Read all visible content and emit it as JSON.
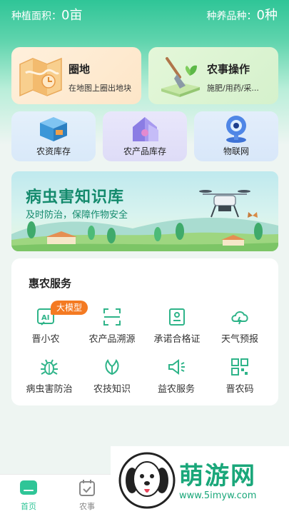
{
  "stats": {
    "area_label": "种植面积：",
    "area_value": "0亩",
    "variety_label": "种养品种：",
    "variety_value": "0种"
  },
  "cards": {
    "plot": {
      "title": "圈地",
      "subtitle": "在地图上圈出地块"
    },
    "ops": {
      "title": "农事操作",
      "subtitle": "施肥/用药/采..."
    }
  },
  "shortcuts": [
    {
      "label": "农资库存",
      "icon": "warehouse-box-icon"
    },
    {
      "label": "农产品库存",
      "icon": "house-icon"
    },
    {
      "label": "物联网",
      "icon": "camera-icon"
    }
  ],
  "banner": {
    "title": "病虫害知识库",
    "subtitle": "及时防治，保障作物安全"
  },
  "service": {
    "title": "惠农服务",
    "badge": "大模型",
    "items": [
      {
        "label": "晋小农",
        "icon": "ai-icon"
      },
      {
        "label": "农产品溯源",
        "icon": "scan-icon"
      },
      {
        "label": "承诺合格证",
        "icon": "certificate-icon"
      },
      {
        "label": "天气预报",
        "icon": "weather-icon"
      },
      {
        "label": "病虫害防治",
        "icon": "bug-icon"
      },
      {
        "label": "农技知识",
        "icon": "leaf-icon"
      },
      {
        "label": "益农服务",
        "icon": "megaphone-icon"
      },
      {
        "label": "晋农码",
        "icon": "qrcode-icon"
      }
    ]
  },
  "tabs": [
    {
      "label": "首页",
      "active": true
    },
    {
      "label": "农事",
      "active": false
    }
  ],
  "watermark": {
    "text": "萌游网",
    "url": "www.5imyw.com"
  },
  "colors": {
    "primary": "#2fc597",
    "accent": "#1aa77a",
    "badge": "#f47a22"
  }
}
